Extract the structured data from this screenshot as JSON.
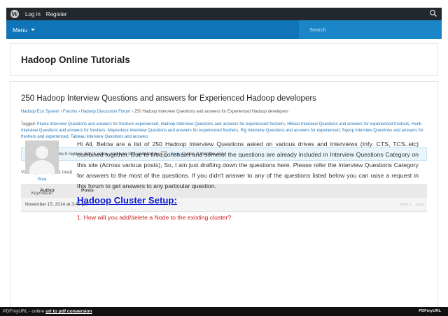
{
  "adminbar": {
    "login": "Log in",
    "register": "Register",
    "logo": "W"
  },
  "nav": {
    "menu_label": "Menu",
    "search_placeholder": "Search"
  },
  "site": {
    "title": "Hadoop Online Tutorials"
  },
  "topic": {
    "title": "250 Hadoop Interview Questions and answers for Experienced Hadoop developers",
    "breadcrumb": [
      "Hadoop Eco System",
      "Forums",
      "Hadoop Discussion Forum",
      "250 Hadoop Interview Questions and answers for Experienced Hadoop developers"
    ],
    "breadcrumb_sep": "›",
    "tags_label": "Tagged: ",
    "tags": [
      "Flume Interview Questions and answers for freshers experienced",
      "Hadoop Interview Questions and answers for experienced freshers",
      "HBase Interview Questions and answers for experienced freshers",
      "Hunk Interview Questions and answers for freshers",
      "Mapreduce Interview Questions and answers for experienced freshers",
      "Pig Interview Questions and answers for experienced",
      "Sqoop Interview Questions and answers for freshers and experienced",
      "Tableau Interview Questions and answers"
    ],
    "notice_text": "This topic contains 0 replies, has 1 voice, and was last updated by",
    "notice_user": "Siva",
    "notice_time": "1 year, 3 months ago.",
    "viewing": "Viewing 1 post (of 1 total)"
  },
  "table": {
    "col_author": "Author",
    "col_posts": "Posts"
  },
  "post": {
    "date": "November 15, 2014 at 3:40 pm",
    "reply": "REPLY",
    "id": "#1823",
    "author_name": "Siva",
    "author_role": "Keymaster",
    "body": "Hi All, Below are a list of 250 Hadoop Interview Questions asked on various drives and Interviews (Infy. CTS, TCS..etc) combined together. Due to time constraint and some of the questions are already included in Interview Questions Category on this site (Across various posts), So, I am just drafting down the questions here. Please refer the Interview Questions Category for answers to the most of the questions. If you didn't answer to any of the questions listed below you can raise a request in this forum to get answers to any particular question.",
    "section_heading": "Hadoop Cluster Setup:",
    "question_1": "1. How will you add/delete a Node to the existing cluster?"
  },
  "footer": {
    "text": "PDFmyURL - online ",
    "link": "url to pdf conversion",
    "brand": "PDFmyURL"
  },
  "colors": {
    "navbar": "#0f74b8",
    "adminbar": "#23282d",
    "link": "#1f73b7",
    "heading_blue": "#0b1ad1",
    "question_red": "#cc1b1b"
  },
  "icons": {
    "wordpress_logo": "wordpress-logo-icon",
    "search": "search-icon",
    "menu_caret": "caret-down-icon"
  }
}
